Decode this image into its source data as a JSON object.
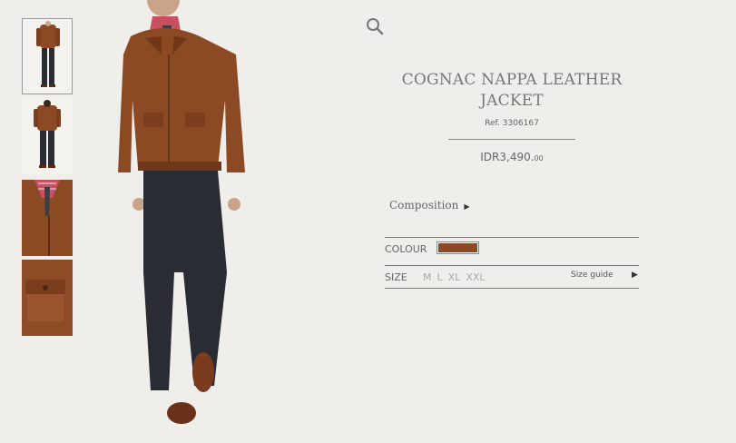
{
  "product": {
    "title": "COGNAC NAPPA LEATHER JACKET",
    "ref": "Ref. 3306167",
    "price_main": "IDR3,490.",
    "price_decimals": "00",
    "composition_label": "Composition",
    "colour_label": "COLOUR",
    "colour_hex": "#8b4a24",
    "size_label": "SIZE",
    "sizes": [
      "M",
      "L",
      "XL",
      "XXL"
    ],
    "size_guide_label": "Size guide"
  },
  "thumbnails": [
    "full-front",
    "full-back",
    "shirt-detail",
    "pocket-detail"
  ],
  "icons": {
    "search": "search-icon",
    "composition_arrow": "triangle-right-icon",
    "size_guide_arrow": "triangle-right-icon"
  },
  "colors": {
    "leather": "#8b4a24",
    "background": "#f0eeeb"
  }
}
